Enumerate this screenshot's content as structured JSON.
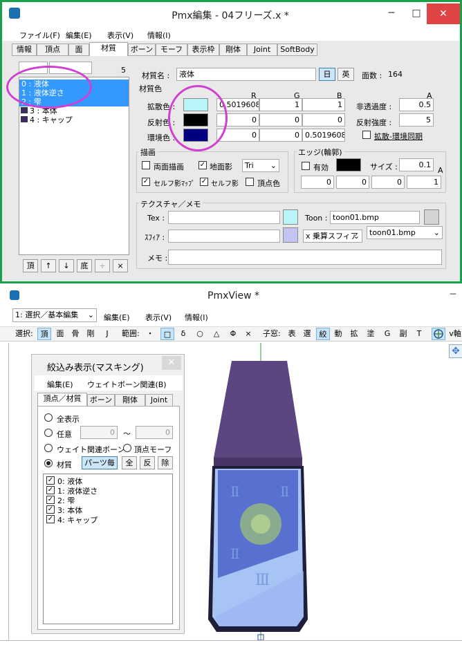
{
  "editor": {
    "title": "Pmx編集 - 04フリーズ.x *",
    "menus": [
      "ファイル(F)",
      "編集(E)",
      "表示(V)",
      "情報(I)"
    ],
    "tabs": [
      "情報",
      "頂点",
      "面",
      "材質",
      "ボーン",
      "モーフ",
      "表示枠",
      "剛体",
      "Joint",
      "SoftBody"
    ],
    "list_count": "5",
    "materials": [
      "0 : 液体",
      "1 : 液体逆さ",
      "2 : 雫",
      "3 : 本体",
      "4 : キャップ"
    ],
    "list_buttons": [
      "頂",
      "↑",
      "↓",
      "底",
      "+",
      "×"
    ],
    "material_name_label": "材質名 :",
    "material_name": "液体",
    "lang_jp": "日",
    "lang_en": "英",
    "face_count_label": "面数 :",
    "face_count": "164",
    "material_color_label": "材質色",
    "col_r": "R",
    "col_g": "G",
    "col_b": "B",
    "col_a": "A",
    "diffuse_label": "拡散色 :",
    "diffuse": [
      "0.5019608",
      "1",
      "1"
    ],
    "diffuse_color": "#b8f4f8",
    "specular_label": "反射色 :",
    "specular": [
      "0",
      "0",
      "0"
    ],
    "specular_color": "#000000",
    "ambient_label": "環境色 :",
    "ambient": [
      "0",
      "0",
      "0.5019608"
    ],
    "ambient_color": "#000080",
    "opacity_label": "非透過度 :",
    "opacity": "0.5",
    "spec_power_label": "反射強度 :",
    "spec_power": "5",
    "sync_label": "拡散-環境同期",
    "draw_label": "描画",
    "draw_double": "両面描画",
    "draw_ground": "地面影",
    "draw_mode": "Tri",
    "draw_selfmap": "セルフ影ﾏｯﾌﾟ",
    "draw_self": "セルフ影",
    "draw_vcolor": "頂点色",
    "edge_label": "エッジ(輪郭)",
    "edge_enable": "有効",
    "edge_size_label": "サイズ :",
    "edge_size": "0.1",
    "edge_a": "A",
    "edge_values": [
      "0",
      "0",
      "0",
      "1"
    ],
    "texture_label": "テクスチャ／メモ",
    "tex_label": "Tex :",
    "toon_label": "Toon :",
    "toon_value": "toon01.bmp",
    "sphere_label": "ｽﾌｨｱ :",
    "sphere_mode": "x 乗算スフィア",
    "toon_select": "toon01.bmp",
    "memo_label": "メモ :"
  },
  "viewer": {
    "title": "PmxView *",
    "mode": "1: 選択／基本編集",
    "menus": [
      "編集(E)",
      "表示(V)",
      "情報(I)"
    ],
    "tb_select_label": "選択:",
    "tb_select": [
      "頂",
      "面",
      "骨",
      "剛",
      "J"
    ],
    "tb_range_label": "範囲:",
    "tb_range": [
      "・",
      "□",
      "δ",
      "○",
      "△",
      "Φ",
      "×"
    ],
    "tb_child_label": "子窓:",
    "tb_child": [
      "表",
      "選",
      "絞",
      "動",
      "拡",
      "塗",
      "G",
      "副",
      "T"
    ],
    "tb_axis": "v軸",
    "dialog_title": "絞込み表示(マスキング)",
    "dialog_menus": [
      "編集(E)",
      "ウェイトボーン関連(B)"
    ],
    "dialog_tabs": [
      "頂点／材質",
      "ボーン",
      "剛体",
      "Joint"
    ],
    "opt_all": "全表示",
    "opt_any": "任意",
    "opt_any_from": "0",
    "opt_tilde": "〜",
    "opt_any_to": "0",
    "opt_weight": "ウェイト関連ボーン",
    "opt_vmorph": "頂点モーフ",
    "opt_material": "材質",
    "btn_parts": "パーツ毎",
    "btn_all": "全",
    "btn_inv": "反",
    "btn_remove": "除",
    "materials": [
      "0: 液体",
      "1: 液体逆さ",
      "2: 雫",
      "3: 本体",
      "4: キャップ"
    ]
  }
}
